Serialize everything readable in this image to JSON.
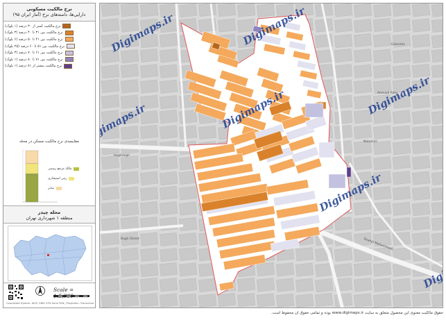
{
  "legend": {
    "title_line1": "نرخ مالکیت مسکونی",
    "title_line2": "دارایی‌ها، دامنه‌های نرخ (آمار ایران ۹۵)",
    "items": [
      {
        "label": "نرخ مالکیت کمتر از ۳۰ درصد (۱ بلوک)",
        "color": "#b5651d"
      },
      {
        "label": "نرخ مالکیت بین ۳۱ تا ۴۰ درصد (۳ بلوک)",
        "color": "#d9822b"
      },
      {
        "label": "نرخ مالکیت بین ۴۱ تا ۵۰ درصد (۶ بلوک)",
        "color": "#f4a95c"
      },
      {
        "label": "نرخ مالکیت بین ۵۱ تا ۶۰ درصد (۲۵ بلوک)",
        "color": "#e2e1ef"
      },
      {
        "label": "نرخ مالکیت بین ۶۱ تا ۷۰ درصد (۳ بلوک)",
        "color": "#c3c1e0"
      },
      {
        "label": "نرخ مالکیت بین ۷۱ تا ۸۰ درصد (۱ بلوک)",
        "color": "#8e84c2"
      },
      {
        "label": "نرخ مالکیت بیشتر از ۸۱ درصد (۱ بلوک)",
        "color": "#5b3f8c"
      }
    ]
  },
  "bar_chart": {
    "title": "مقایسه‌ی نرخ مالکیت مسکن در محله",
    "keys": [
      {
        "label": "مالک مرجع رسمی",
        "color": "#b7c23f"
      },
      {
        "label": "رمی استیجاری",
        "color": "#f1e47a"
      },
      {
        "label": "سایر",
        "color": "#f8d9a8"
      }
    ],
    "segments": [
      {
        "fraction": 0.25,
        "color": "#f8d9a8"
      },
      {
        "fraction": 0.2,
        "color": "#f1e47a"
      },
      {
        "fraction": 0.55,
        "color": "#9aa543"
      }
    ]
  },
  "sub": {
    "line1": "محله چیذر",
    "line2": "منطقه ۱ شهرداری تهران"
  },
  "scale": {
    "text": "Scale = 1:5,000"
  },
  "credit": "Coordinate System: WGS 1984 UTM Zone 39N | Projection: Transverse Mercator",
  "watermarks": [
    "Digimaps.ir",
    "Digimaps.ir",
    "Digimaps.ir",
    "Digimaps.ir",
    "Digimaps.ir",
    "Digimaps.ir",
    "Digimaps.ir"
  ],
  "street_labels": [
    "Hoghoogh",
    "Shahid Mohammadi",
    "Bagh Street",
    "Ahmadi Alley",
    "Golestan",
    "Niavaran"
  ],
  "bottom_note": "حقوق مالکیت معنوی این محصول متعلق به سایت www.digimaps.ir بوده و تمامی حقوق آن محفوظ است."
}
